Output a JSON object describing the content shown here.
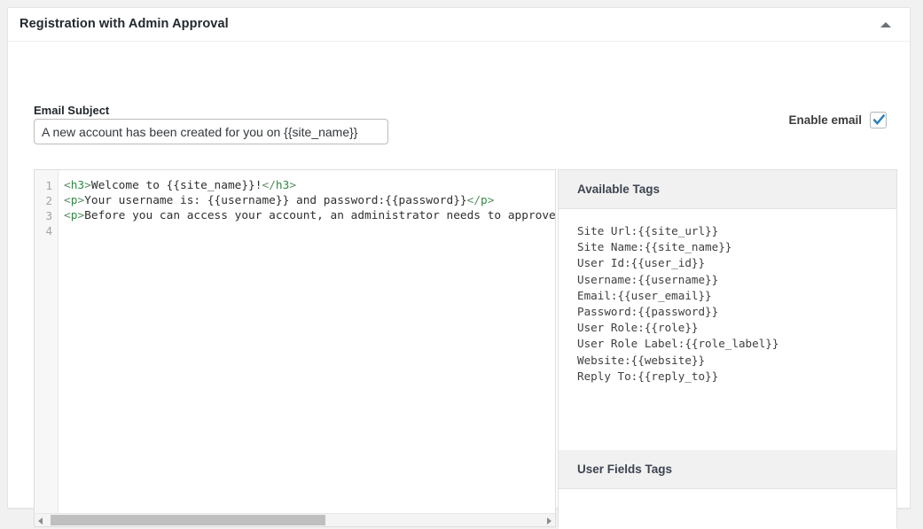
{
  "metabox": {
    "title": "Registration with Admin Approval",
    "collapse_icon": "triangle-up-icon"
  },
  "form": {
    "subject_label": "Email Subject",
    "subject_value": "A new account has been created for you on {{site_name}}",
    "subject_placeholder": "Email Subject",
    "enable_email_label": "Enable email",
    "enable_email_checked": true,
    "check_icon": "checkmark-icon",
    "accent_color": "#2980b9"
  },
  "editor": {
    "line_numbers": [
      "1",
      "2",
      "3",
      "4"
    ],
    "lines": [
      [
        {
          "t": "punc",
          "s": "<"
        },
        {
          "t": "tag",
          "s": "h3"
        },
        {
          "t": "punc",
          "s": ">"
        },
        {
          "t": "txt",
          "s": "Welcome to {{site_name}}!"
        },
        {
          "t": "punc",
          "s": "</"
        },
        {
          "t": "tag",
          "s": "h3"
        },
        {
          "t": "punc",
          "s": ">"
        }
      ],
      [
        {
          "t": "punc",
          "s": "<"
        },
        {
          "t": "tag",
          "s": "p"
        },
        {
          "t": "punc",
          "s": ">"
        },
        {
          "t": "txt",
          "s": "Your username is: {{username}} and password:{{password}}"
        },
        {
          "t": "punc",
          "s": "</"
        },
        {
          "t": "tag",
          "s": "p"
        },
        {
          "t": "punc",
          "s": ">"
        }
      ],
      [
        {
          "t": "punc",
          "s": "<"
        },
        {
          "t": "tag",
          "s": "p"
        },
        {
          "t": "punc",
          "s": ">"
        },
        {
          "t": "txt",
          "s": "Before you can access your account, an administrator needs to approve it."
        }
      ],
      []
    ],
    "scrollbar": {
      "left_arrow_icon": "triangle-left-icon",
      "right_arrow_icon": "triangle-right-icon"
    }
  },
  "tags_panel": {
    "available_tags_title": "Available Tags",
    "available_tags": [
      "Site Url:{{site_url}}",
      "Site Name:{{site_name}}",
      "User Id:{{user_id}}",
      "Username:{{username}}",
      "Email:{{user_email}}",
      "Password:{{password}}",
      "User Role:{{role}}",
      "User Role Label:{{role_label}}",
      "Website:{{website}}",
      "Reply To:{{reply_to}}"
    ],
    "user_fields_title": "User Fields Tags",
    "user_fields_tags": []
  }
}
